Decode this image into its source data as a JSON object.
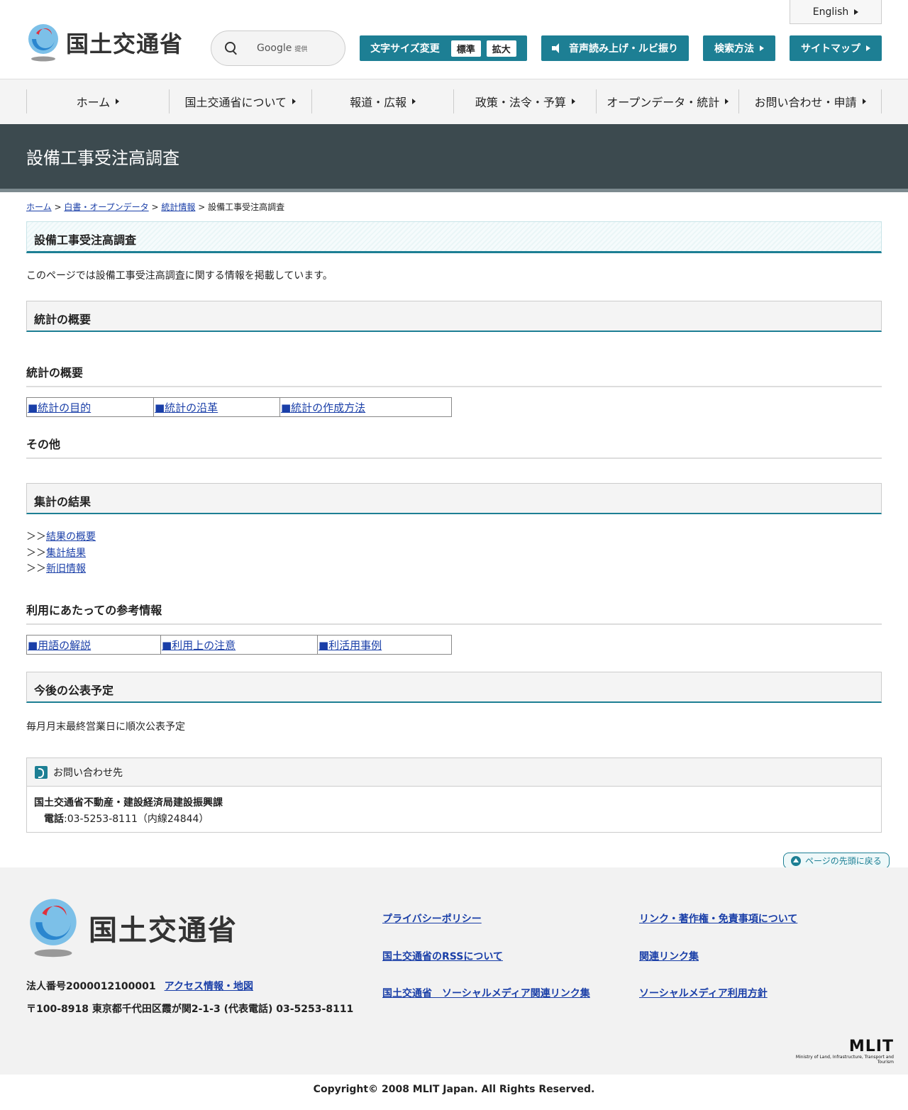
{
  "header": {
    "logo_text": "国土交通省",
    "search": {
      "brand": "Google",
      "suffix": "提供"
    },
    "english_label": "English",
    "font_size": {
      "label": "文字サイズ変更",
      "standard": "標準",
      "large": "拡大"
    },
    "voice_label": "音声読み上げ・ルビ振り",
    "search_method_label": "検索方法",
    "sitemap_label": "サイトマップ"
  },
  "nav": {
    "items": [
      {
        "label": "ホーム"
      },
      {
        "label": "国土交通省について"
      },
      {
        "label": "報道・広報"
      },
      {
        "label": "政策・法令・予算"
      },
      {
        "label": "オープンデータ・統計"
      },
      {
        "label": "お問い合わせ・申請"
      }
    ]
  },
  "page": {
    "title": "設備工事受注高調査",
    "breadcrumb": {
      "home": "ホーム",
      "sep": ">",
      "whitepaper": "白書・オープンデータ",
      "stats": "統計情報",
      "current": "設備工事受注高調査"
    },
    "heading": "設備工事受注高調査",
    "intro": "このページでは設備工事受注高調査に関する情報を掲載しています。",
    "overview_section": "統計の概要",
    "overview_sub": "統計の概要",
    "overview_links": [
      "■統計の目的",
      "■統計の沿革",
      "■統計の作成方法"
    ],
    "other_sub": "その他",
    "results_section": "集計の結果",
    "results_prefix": "＞＞",
    "results_links": [
      "結果の概要",
      "集計結果",
      "新旧情報"
    ],
    "reference_sub": "利用にあたっての参考情報",
    "reference_links": [
      "■用語の解説",
      "■利用上の注意",
      "■利活用事例"
    ],
    "schedule_section": "今後の公表予定",
    "schedule_text": "毎月月末最終営業日に順次公表予定",
    "contact": {
      "title": "お問い合わせ先",
      "org": "国土交通省不動産・建設経済局建設振興課",
      "tel_label": "電話",
      "tel_value": ":03-5253-8111（内線24844）"
    },
    "pagetop_label": "ページの先頭に戻る"
  },
  "footer": {
    "logo_text": "国土交通省",
    "corp_number": "法人番号2000012100001",
    "access_link": "アクセス情報・地図",
    "address": "〒100-8918 東京都千代田区霞が関2-1-3 (代表電話) 03-5253-8111",
    "links": [
      "プライバシーポリシー",
      "リンク・著作権・免責事項について",
      "国土交通省のRSSについて",
      "関連リンク集",
      "国土交通省　ソーシャルメディア関連リンク集",
      "ソーシャルメディア利用方針"
    ],
    "mlit_word": "MLIT",
    "mlit_sub": "Ministry of Land, Infrastructure, Transport and Tourism",
    "copyright": "Copyright© 2008 MLIT Japan. All Rights Reserved."
  },
  "colors": {
    "accent": "#1d7f94",
    "title_band": "#3c4a4f",
    "link": "#1a3fa8"
  }
}
